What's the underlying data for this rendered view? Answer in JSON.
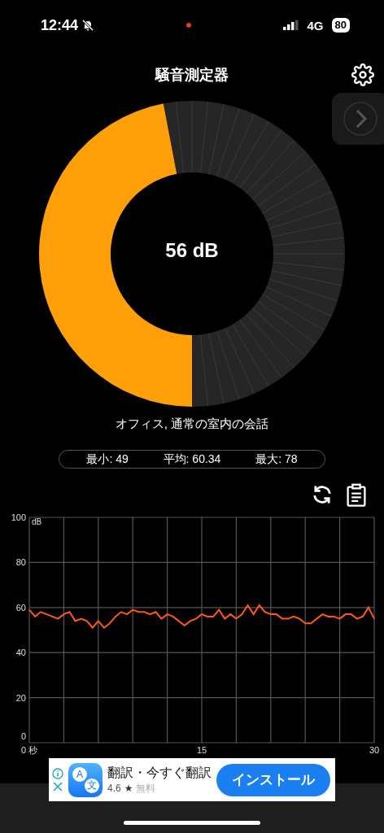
{
  "status_bar": {
    "time": "12:44",
    "network": "4G",
    "battery": "80"
  },
  "header": {
    "title": "騒音測定器"
  },
  "gauge": {
    "reading": "56 dB"
  },
  "description": "オフィス, 通常の室内の会話",
  "stats": [
    "最小: 49",
    "平均: 60.34",
    "最大: 78"
  ],
  "chart": {
    "chart_data": {
      "type": "line",
      "ylabel": "dB",
      "grid": true,
      "xlim": [
        0,
        30
      ],
      "ylim": [
        0,
        100
      ],
      "xticks": [
        {
          "value": 0,
          "label": "0 秒"
        },
        15,
        30
      ],
      "yticks": [
        0,
        20,
        40,
        60,
        80,
        100
      ],
      "x": [
        0,
        0.5,
        1,
        1.5,
        2,
        2.5,
        3,
        3.5,
        4,
        4.5,
        5,
        5.5,
        6,
        6.5,
        7,
        7.5,
        8,
        8.5,
        9,
        9.5,
        10,
        10.5,
        11,
        11.5,
        12,
        12.5,
        13,
        13.5,
        14,
        14.5,
        15,
        15.5,
        16,
        16.5,
        17,
        17.5,
        18,
        18.5,
        19,
        19.5,
        20,
        20.5,
        21,
        21.5,
        22,
        22.5,
        23,
        23.5,
        24,
        24.5,
        25,
        25.5,
        26,
        26.5,
        27,
        27.5,
        28,
        28.5,
        29,
        29.5,
        30
      ],
      "series": [
        {
          "color": "#ff5a14",
          "values": [
            59,
            56,
            58,
            57,
            56,
            55,
            57,
            58,
            54,
            55,
            54,
            51,
            54,
            51,
            53,
            56,
            58,
            57,
            59,
            58,
            58,
            57,
            58,
            55,
            57,
            56,
            54,
            52,
            54,
            55,
            57,
            56,
            56,
            59,
            55,
            57,
            55,
            57,
            61,
            57,
            61,
            58,
            57,
            57,
            55,
            55,
            56,
            55,
            53,
            53,
            55,
            57,
            56,
            56,
            55,
            57,
            57,
            55,
            56,
            60,
            55
          ]
        }
      ]
    }
  },
  "ad": {
    "icon_glyphs": [
      "A",
      "文"
    ],
    "title": "翻訳・今すぐ翻訳",
    "rating": "4.6",
    "star": "★",
    "price": "無料",
    "install": "インストール"
  }
}
